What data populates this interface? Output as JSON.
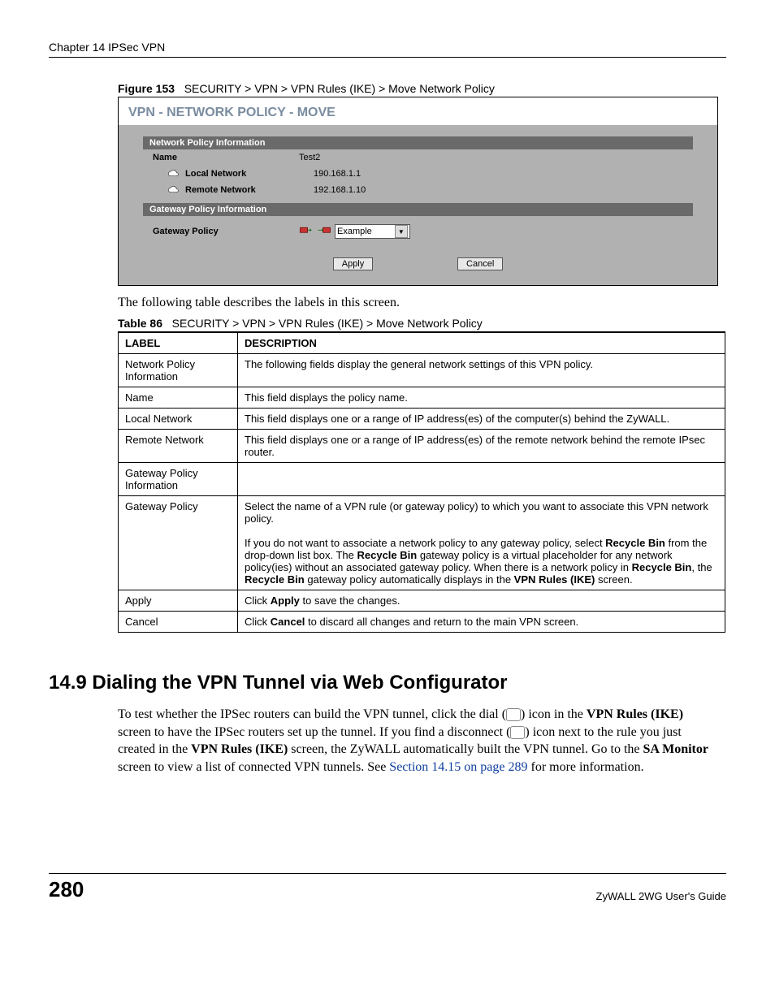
{
  "header": {
    "chapter": "Chapter 14 IPSec VPN"
  },
  "figure": {
    "label": "Figure 153",
    "path": "SECURITY > VPN > VPN Rules (IKE) > Move Network Policy"
  },
  "screenshot": {
    "title": "VPN - NETWORK POLICY - MOVE",
    "sec1": "Network Policy Information",
    "name_lbl": "Name",
    "name_val": "Test2",
    "local_lbl": "Local Network",
    "local_val": "190.168.1.1",
    "remote_lbl": "Remote Network",
    "remote_val": "192.168.1.10",
    "sec2": "Gateway Policy Information",
    "gw_lbl": "Gateway Policy",
    "gw_select": "Example",
    "apply": "Apply",
    "cancel": "Cancel"
  },
  "intro": "The following table describes the labels in this screen.",
  "table_caption": {
    "label": "Table 86",
    "path": "SECURITY > VPN > VPN Rules (IKE) > Move Network Policy"
  },
  "th": {
    "c1": "LABEL",
    "c2": "DESCRIPTION"
  },
  "rows": {
    "r1l": "Network Policy Information",
    "r1d": "The following fields display the general network settings of this VPN policy.",
    "r2l": "Name",
    "r2d": "This field displays the policy name.",
    "r3l": "Local Network",
    "r3d": "This field displays one or a range of IP address(es) of the computer(s) behind the ZyWALL.",
    "r4l": "Remote Network",
    "r4d": "This field displays one or a range of IP address(es) of the remote network behind the remote IPsec router.",
    "r5l": "Gateway Policy Information",
    "r5d": "",
    "r6l": "Gateway Policy",
    "r6d_p1": "Select the name of a VPN rule (or gateway policy) to which you want to associate this VPN network policy.",
    "r6d_p2a": "If you do not want to associate a network policy to any gateway policy, select ",
    "r6d_p2b": "Recycle Bin",
    "r6d_p2c": " from the drop-down list box. The ",
    "r6d_p2d": "Recycle Bin",
    "r6d_p2e": " gateway policy is a virtual placeholder for any network policy(ies) without an associated gateway policy. When there is a network policy in ",
    "r6d_p2f": "Recycle Bin",
    "r6d_p2g": ", the ",
    "r6d_p2h": "Recycle Bin",
    "r6d_p2i": " gateway policy automatically displays in the ",
    "r6d_p2j": "VPN Rules (IKE)",
    "r6d_p2k": " screen.",
    "r7l": "Apply",
    "r7d_a": "Click ",
    "r7d_b": "Apply",
    "r7d_c": " to save the changes.",
    "r8l": "Cancel",
    "r8d_a": "Click ",
    "r8d_b": "Cancel",
    "r8d_c": " to discard all changes and return to the main VPN screen."
  },
  "section": {
    "heading": "14.9  Dialing the VPN Tunnel via Web Configurator",
    "p_a": "To test whether the IPSec routers can build the VPN tunnel, click the dial (",
    "p_b": ") icon in the ",
    "p_c": "VPN Rules (IKE)",
    "p_d": " screen to have the IPSec routers set up the tunnel. If you find a disconnect (",
    "p_e": ") icon next to the rule you just created in the ",
    "p_f": "VPN Rules (IKE)",
    "p_g": " screen, the ZyWALL automatically built the VPN tunnel. Go to the ",
    "p_h": "SA Monitor",
    "p_i": " screen to view a list of connected VPN tunnels. See ",
    "p_link": "Section 14.15 on page 289",
    "p_j": " for more information."
  },
  "footer": {
    "page": "280",
    "guide": "ZyWALL 2WG User's Guide"
  }
}
